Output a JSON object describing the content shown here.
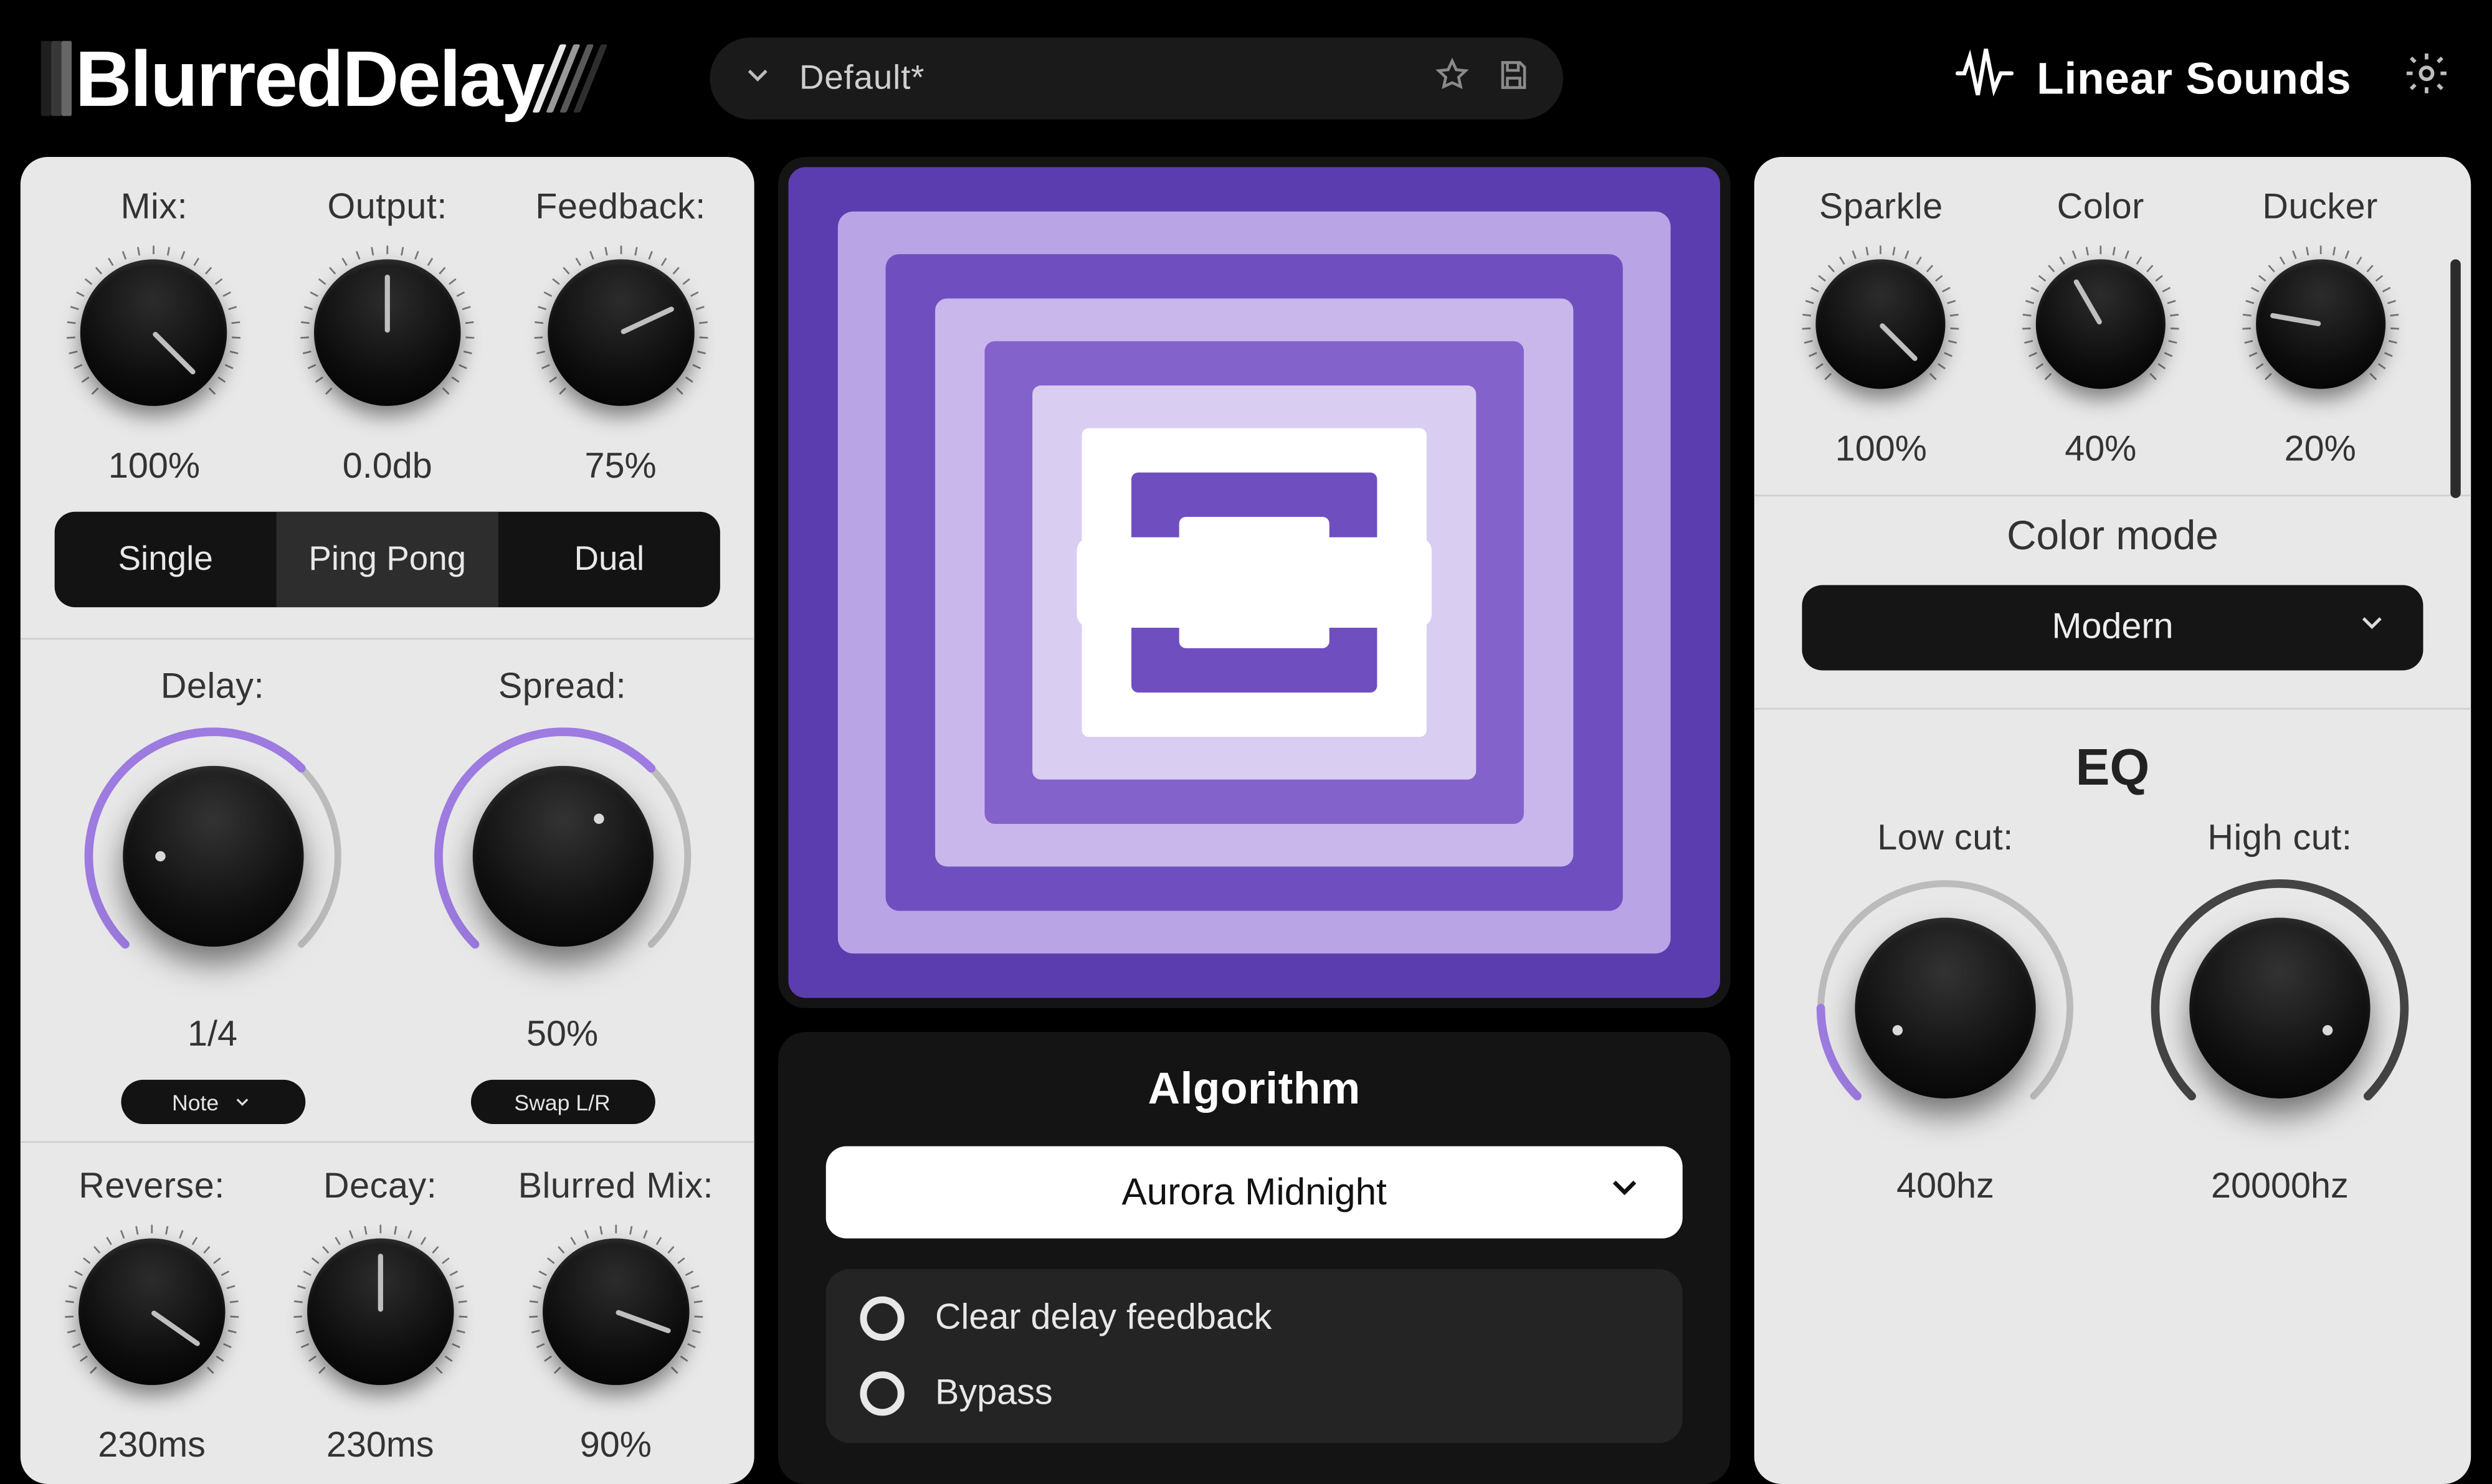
{
  "header": {
    "product_name": "BlurredDelay",
    "preset_name": "Default*",
    "brand_name": "Linear Sounds"
  },
  "left": {
    "knobs_top": [
      {
        "id": "mix",
        "label": "Mix:",
        "value": "100%",
        "angle": 135
      },
      {
        "id": "output",
        "label": "Output:",
        "value": "0.0db",
        "angle": 0
      },
      {
        "id": "feedback",
        "label": "Feedback:",
        "value": "75%",
        "angle": 65
      }
    ],
    "mode_tabs": [
      {
        "id": "single",
        "label": "Single",
        "active": false
      },
      {
        "id": "pingpong",
        "label": "Ping Pong",
        "active": true
      },
      {
        "id": "dual",
        "label": "Dual",
        "active": false
      }
    ],
    "big_knobs": [
      {
        "id": "delay",
        "label": "Delay:",
        "value": "1/4",
        "pill": "Note",
        "pill_has_chevron": true,
        "arc_start": -135,
        "arc_end": 45,
        "dot_angle": -90,
        "accent": "#9d7be0"
      },
      {
        "id": "spread",
        "label": "Spread:",
        "value": "50%",
        "pill": "Swap L/R",
        "pill_has_chevron": false,
        "arc_start": -135,
        "arc_end": 45,
        "dot_angle": 45,
        "accent": "#9d7be0"
      }
    ],
    "knobs_bottom": [
      {
        "id": "reverse",
        "label": "Reverse:",
        "value": "230ms",
        "angle": 125
      },
      {
        "id": "decay",
        "label": "Decay:",
        "value": "230ms",
        "angle": 0
      },
      {
        "id": "blurredmix",
        "label": "Blurred Mix:",
        "value": "90%",
        "angle": 110
      }
    ]
  },
  "center": {
    "algorithm_heading": "Algorithm",
    "algorithm_selected": "Aurora Midnight",
    "options": [
      {
        "id": "clear",
        "label": "Clear delay feedback"
      },
      {
        "id": "bypass",
        "label": "Bypass"
      }
    ],
    "accent": "#8d6cd4"
  },
  "right": {
    "knobs_top": [
      {
        "id": "sparkle",
        "label": "Sparkle",
        "value": "100%",
        "angle": 135
      },
      {
        "id": "color",
        "label": "Color",
        "value": "40%",
        "angle": -30
      },
      {
        "id": "ducker",
        "label": "Ducker",
        "value": "20%",
        "angle": -80
      }
    ],
    "color_mode_label": "Color mode",
    "color_mode_value": "Modern",
    "eq_label": "EQ",
    "eq_knobs": [
      {
        "id": "lowcut",
        "label": "Low cut:",
        "value": "400hz",
        "arc_start": -135,
        "arc_end": -90,
        "dot_angle": -115,
        "accent": "#9d7be0"
      },
      {
        "id": "highcut",
        "label": "High cut:",
        "value": "20000hz",
        "arc_start": -135,
        "arc_end": 135,
        "dot_angle": 115,
        "accent": "#444"
      }
    ]
  }
}
